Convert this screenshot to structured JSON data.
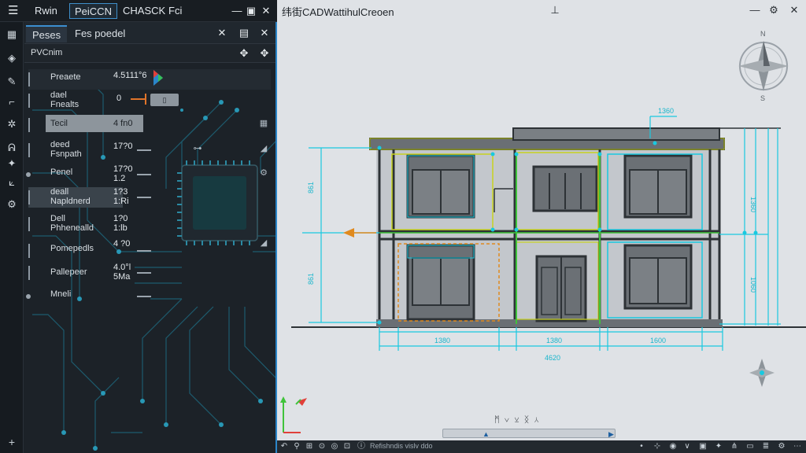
{
  "menubar": {
    "items": [
      "Rwin",
      "PeiCCN",
      "CHASCK",
      "Fci"
    ]
  },
  "panel": {
    "tabs": [
      "Peses",
      "Fes poedel"
    ],
    "subheader": "PVCnim",
    "rows": [
      {
        "label": "Preaete",
        "value": "4.5111°6"
      },
      {
        "label": "dael\nFnealts",
        "value": "0"
      },
      {
        "label": "Tecil",
        "value": "4 fn0"
      },
      {
        "label": "deed\nFsnpath",
        "value": "17?0"
      },
      {
        "label": "Penel",
        "value": "17?0\n1.2"
      },
      {
        "label": "deall\nNapldnerd",
        "value": "1?3\n1:Ri"
      },
      {
        "label": "Dell\nPhhenealld",
        "value": "1?0\n1:lb"
      },
      {
        "label": "Pomepedls",
        "value": "4 ?0"
      },
      {
        "label": "Pallepeer",
        "value": "4.0°l\n5Ma"
      },
      {
        "label": "Mneli",
        "value": ""
      }
    ]
  },
  "canvas": {
    "title": "纬街CADWattihulCreoen",
    "dimensions": {
      "left_upper": "861",
      "left_lower": "861",
      "right_upper": "1360",
      "right_lower": "1060",
      "bottom_1": "1380",
      "bottom_2": "1380",
      "bottom_3": "1600",
      "bottom_mid": "4620",
      "top_arrow": "1360"
    },
    "bottom_status": "Refishndis vislv ddo"
  },
  "colors": {
    "accent": "#2b86c9",
    "cyan_dim": "#19c9e0",
    "yellow_line": "#c8d21e",
    "green_line": "#3fc33a",
    "orange_line": "#e08a1e",
    "wall": "#5b5f64"
  }
}
